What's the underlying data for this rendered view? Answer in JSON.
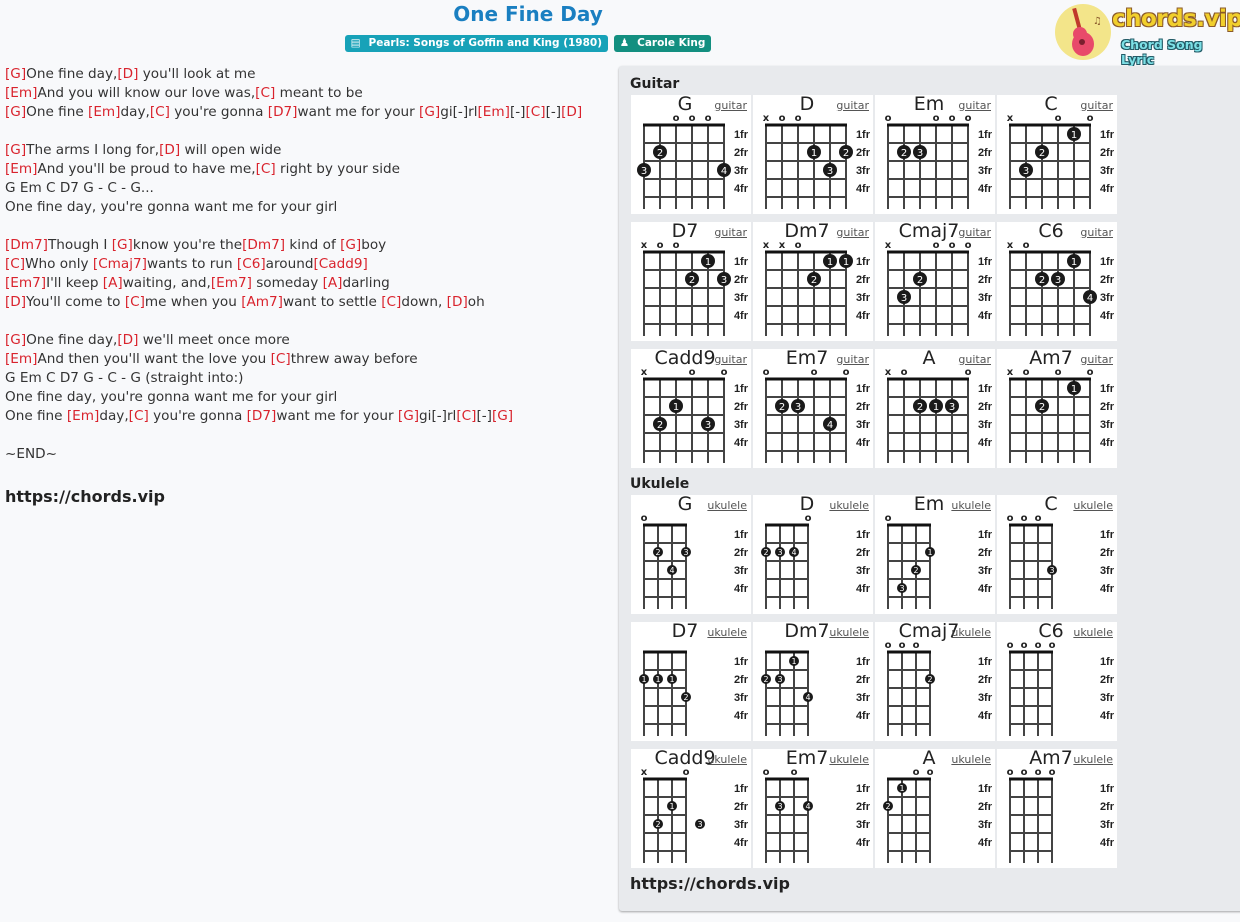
{
  "header": {
    "title": "One Fine Day",
    "album_badge": "Pearls: Songs of Goffin and King (1980)",
    "artist_badge": "Carole King",
    "logo_brand": "chords.vip",
    "logo_tagline": "Chord Song Lyric"
  },
  "colors": {
    "title": "#1a7fc1",
    "chord": "#d9232d",
    "album_badge": "#17a2b8",
    "artist_badge": "#138f80"
  },
  "lyrics": [
    [
      {
        "c": "G"
      },
      {
        "t": "One fine day,"
      },
      {
        "c": "D"
      },
      {
        "t": " you'll look at me"
      }
    ],
    [
      {
        "c": "Em"
      },
      {
        "t": "And you will know our love was,"
      },
      {
        "c": "C"
      },
      {
        "t": " meant to be"
      }
    ],
    [
      {
        "c": "G"
      },
      {
        "t": "One fine "
      },
      {
        "c": "Em"
      },
      {
        "t": "day,"
      },
      {
        "c": "C"
      },
      {
        "t": " you're gonna "
      },
      {
        "c": "D7"
      },
      {
        "t": "want me for your "
      },
      {
        "c": "G"
      },
      {
        "t": "gi[-]rl"
      },
      {
        "c": "Em"
      },
      {
        "t": "[-]"
      },
      {
        "c": "C"
      },
      {
        "t": "[-]"
      },
      {
        "c": "D"
      }
    ],
    [],
    [
      {
        "c": "G"
      },
      {
        "t": "The arms I long for,"
      },
      {
        "c": "D"
      },
      {
        "t": " will open wide"
      }
    ],
    [
      {
        "c": "Em"
      },
      {
        "t": "And you'll be proud to have me,"
      },
      {
        "c": "C"
      },
      {
        "t": " right by your side"
      }
    ],
    [
      {
        "t": "G Em C D7 G - C - G..."
      }
    ],
    [
      {
        "t": "One fine day, you're gonna want me for your girl"
      }
    ],
    [],
    [
      {
        "c": "Dm7"
      },
      {
        "t": "Though I "
      },
      {
        "c": "G"
      },
      {
        "t": "know you're the"
      },
      {
        "c": "Dm7"
      },
      {
        "t": " kind of "
      },
      {
        "c": "G"
      },
      {
        "t": "boy"
      }
    ],
    [
      {
        "c": "C"
      },
      {
        "t": "Who only "
      },
      {
        "c": "Cmaj7"
      },
      {
        "t": "wants to run "
      },
      {
        "c": "C6"
      },
      {
        "t": "around"
      },
      {
        "c": "Cadd9"
      }
    ],
    [
      {
        "c": "Em7"
      },
      {
        "t": "I'll keep "
      },
      {
        "c": "A"
      },
      {
        "t": "waiting, and,"
      },
      {
        "c": "Em7"
      },
      {
        "t": " someday "
      },
      {
        "c": "A"
      },
      {
        "t": "darling"
      }
    ],
    [
      {
        "c": "D"
      },
      {
        "t": "You'll come to "
      },
      {
        "c": "C"
      },
      {
        "t": "me when you "
      },
      {
        "c": "Am7"
      },
      {
        "t": "want to settle "
      },
      {
        "c": "C"
      },
      {
        "t": "down, "
      },
      {
        "c": "D"
      },
      {
        "t": "oh"
      }
    ],
    [],
    [
      {
        "c": "G"
      },
      {
        "t": "One fine day,"
      },
      {
        "c": "D"
      },
      {
        "t": " we'll meet once more"
      }
    ],
    [
      {
        "c": "Em"
      },
      {
        "t": "And then you'll want the love you "
      },
      {
        "c": "C"
      },
      {
        "t": "threw away before"
      }
    ],
    [
      {
        "t": "G Em C D7 G - C - G (straight into:)"
      }
    ],
    [
      {
        "t": "One fine day, you're gonna want me for your girl"
      }
    ],
    [
      {
        "t": "One fine "
      },
      {
        "c": "Em"
      },
      {
        "t": "day,"
      },
      {
        "c": "C"
      },
      {
        "t": " you're gonna "
      },
      {
        "c": "D7"
      },
      {
        "t": "want me for your "
      },
      {
        "c": "G"
      },
      {
        "t": "gi[-]rl"
      },
      {
        "c": "C"
      },
      {
        "t": "[-]"
      },
      {
        "c": "G"
      }
    ],
    [],
    [
      {
        "t": "~END~"
      }
    ],
    []
  ],
  "lyrics_site": "https://chords.vip",
  "panel": {
    "guitar_title": "Guitar",
    "ukulele_title": "Ukulele",
    "site": "https://chords.vip",
    "fret_labels": [
      "1fr",
      "2fr",
      "3fr",
      "4fr"
    ],
    "guitar": [
      {
        "name": "G",
        "link": "guitar",
        "open": [
          "",
          "",
          "o",
          "o",
          "o",
          ""
        ],
        "dots": [
          [
            2,
            2,
            "2"
          ],
          [
            1,
            3,
            "3"
          ],
          [
            6,
            3,
            "4"
          ]
        ]
      },
      {
        "name": "D",
        "link": "guitar",
        "open": [
          "x",
          "o",
          "o",
          "",
          "",
          ""
        ],
        "dots": [
          [
            4,
            2,
            "1"
          ],
          [
            6,
            2,
            "2"
          ],
          [
            5,
            3,
            "3"
          ]
        ]
      },
      {
        "name": "Em",
        "link": "guitar",
        "open": [
          "o",
          "",
          "",
          "o",
          "o",
          "o"
        ],
        "dots": [
          [
            2,
            2,
            "2"
          ],
          [
            3,
            2,
            "3"
          ]
        ]
      },
      {
        "name": "C",
        "link": "guitar",
        "open": [
          "x",
          "",
          "",
          "o",
          "",
          "o"
        ],
        "dots": [
          [
            5,
            1,
            "1"
          ],
          [
            3,
            2,
            "2"
          ],
          [
            2,
            3,
            "3"
          ]
        ]
      },
      {
        "name": "D7",
        "link": "guitar",
        "open": [
          "x",
          "o",
          "o",
          "",
          "",
          ""
        ],
        "dots": [
          [
            5,
            1,
            "1"
          ],
          [
            4,
            2,
            "2"
          ],
          [
            6,
            2,
            "3"
          ]
        ]
      },
      {
        "name": "Dm7",
        "link": "guitar",
        "open": [
          "x",
          "x",
          "o",
          "",
          "",
          ""
        ],
        "dots": [
          [
            5,
            1,
            "1"
          ],
          [
            6,
            1,
            "1"
          ],
          [
            4,
            2,
            "2"
          ]
        ]
      },
      {
        "name": "Cmaj7",
        "link": "guitar",
        "open": [
          "x",
          "",
          "",
          "o",
          "o",
          "o"
        ],
        "dots": [
          [
            3,
            2,
            "2"
          ],
          [
            2,
            3,
            "3"
          ]
        ]
      },
      {
        "name": "C6",
        "link": "guitar",
        "open": [
          "x",
          "o",
          "",
          "",
          "",
          ""
        ],
        "dots": [
          [
            5,
            1,
            "1"
          ],
          [
            3,
            2,
            "2"
          ],
          [
            4,
            2,
            "3"
          ],
          [
            6,
            3,
            "4"
          ]
        ]
      },
      {
        "name": "Cadd9",
        "link": "guitar",
        "open": [
          "x",
          "",
          "",
          "o",
          "",
          "o"
        ],
        "dots": [
          [
            3,
            2,
            "1"
          ],
          [
            2,
            3,
            "2"
          ],
          [
            5,
            3,
            "3"
          ]
        ]
      },
      {
        "name": "Em7",
        "link": "guitar",
        "open": [
          "o",
          "",
          "",
          "o",
          "",
          "o"
        ],
        "dots": [
          [
            2,
            2,
            "2"
          ],
          [
            3,
            2,
            "3"
          ],
          [
            5,
            3,
            "4"
          ]
        ]
      },
      {
        "name": "A",
        "link": "guitar",
        "open": [
          "x",
          "o",
          "",
          "",
          "",
          "o"
        ],
        "dots": [
          [
            3,
            2,
            "2"
          ],
          [
            4,
            2,
            "1"
          ],
          [
            5,
            2,
            "3"
          ]
        ]
      },
      {
        "name": "Am7",
        "link": "guitar",
        "open": [
          "x",
          "o",
          "",
          "o",
          "",
          "o"
        ],
        "dots": [
          [
            5,
            1,
            "1"
          ],
          [
            3,
            2,
            "2"
          ]
        ]
      }
    ],
    "ukulele": [
      {
        "name": "G",
        "link": "ukulele",
        "open": [
          "o",
          "",
          "",
          ""
        ],
        "dots": [
          [
            2,
            2,
            "2"
          ],
          [
            4,
            2,
            "3"
          ],
          [
            3,
            3,
            "4"
          ]
        ]
      },
      {
        "name": "D",
        "link": "ukulele",
        "open": [
          "",
          "",
          "",
          "o"
        ],
        "dots": [
          [
            1,
            2,
            "2"
          ],
          [
            2,
            2,
            "3"
          ],
          [
            3,
            2,
            "4"
          ]
        ]
      },
      {
        "name": "Em",
        "link": "ukulele",
        "open": [
          "o",
          "",
          "",
          ""
        ],
        "dots": [
          [
            4,
            2,
            "1"
          ],
          [
            3,
            3,
            "2"
          ],
          [
            2,
            4,
            "3"
          ]
        ]
      },
      {
        "name": "C",
        "link": "ukulele",
        "open": [
          "o",
          "o",
          "o",
          ""
        ],
        "dots": [
          [
            4,
            3,
            "3"
          ]
        ]
      },
      {
        "name": "D7",
        "link": "ukulele",
        "open": [
          "",
          "",
          "",
          ""
        ],
        "dots": [
          [
            1,
            2,
            "1"
          ],
          [
            2,
            2,
            "1"
          ],
          [
            3,
            2,
            "1"
          ],
          [
            4,
            3,
            "2"
          ]
        ]
      },
      {
        "name": "Dm7",
        "link": "ukulele",
        "open": [
          "",
          "",
          "",
          ""
        ],
        "dots": [
          [
            3,
            1,
            "1"
          ],
          [
            1,
            2,
            "2"
          ],
          [
            2,
            2,
            "3"
          ],
          [
            4,
            3,
            "4"
          ]
        ]
      },
      {
        "name": "Cmaj7",
        "link": "ukulele",
        "open": [
          "o",
          "o",
          "o",
          ""
        ],
        "dots": [
          [
            4,
            2,
            "2"
          ]
        ]
      },
      {
        "name": "C6",
        "link": "ukulele",
        "open": [
          "o",
          "o",
          "o",
          "o"
        ],
        "dots": []
      },
      {
        "name": "Cadd9",
        "link": "ukulele",
        "open": [
          "x",
          "",
          "",
          "o"
        ],
        "dots": [
          [
            3,
            2,
            "1"
          ],
          [
            2,
            3,
            "2"
          ],
          [
            5,
            3,
            "3"
          ]
        ]
      },
      {
        "name": "Em7",
        "link": "ukulele",
        "open": [
          "o",
          "",
          "o",
          ""
        ],
        "dots": [
          [
            2,
            2,
            "3"
          ],
          [
            4,
            2,
            "4"
          ]
        ]
      },
      {
        "name": "A",
        "link": "ukulele",
        "open": [
          "",
          "",
          "o",
          "o"
        ],
        "dots": [
          [
            2,
            1,
            "1"
          ],
          [
            1,
            2,
            "2"
          ]
        ]
      },
      {
        "name": "Am7",
        "link": "ukulele",
        "open": [
          "o",
          "o",
          "o",
          "o"
        ],
        "dots": []
      }
    ]
  }
}
